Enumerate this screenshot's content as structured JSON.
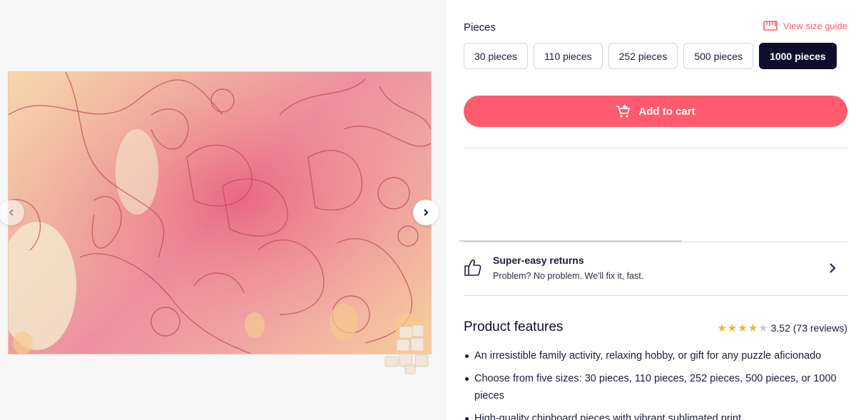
{
  "pieces": {
    "label": "Pieces",
    "size_guide_label": "View size guide",
    "options": [
      "30 pieces",
      "110 pieces",
      "252 pieces",
      "500 pieces",
      "1000 pieces"
    ],
    "selected": "1000 pieces"
  },
  "cart": {
    "add_label": "Add to cart"
  },
  "returns": {
    "title": "Super-easy returns",
    "subtitle": "Problem? No problem. We'll fix it, fast."
  },
  "features": {
    "title": "Product features",
    "rating_value": 3.52,
    "rating_text": "3.52 (73 reviews)",
    "stars_filled": 4,
    "stars_total": 5,
    "items": [
      "An irresistible family activity, relaxing hobby, or gift for any puzzle aficionado",
      "Choose from five sizes: 30 pieces, 110 pieces, 252 pieces, 500 pieces, or 1000 pieces",
      "High-quality chipboard pieces with vibrant sublimated print"
    ]
  },
  "colors": {
    "accent": "#ff5a6e",
    "selected_bg": "#0e0e2c",
    "star": "#f5b32c"
  },
  "icons": {
    "size_guide": "ruler-icon",
    "cart": "cart-plus-icon",
    "returns": "thumbs-up-icon",
    "prev": "chevron-left-icon",
    "next": "chevron-right-icon",
    "returns_arrow": "chevron-right-icon"
  }
}
